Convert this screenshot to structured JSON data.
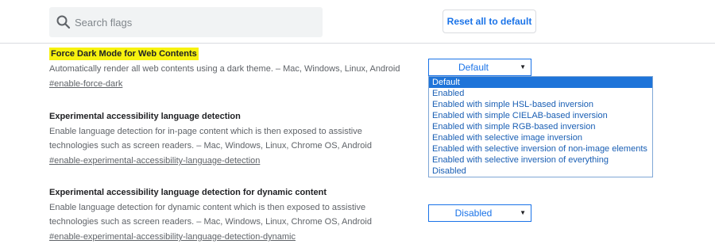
{
  "search": {
    "placeholder": "Search flags"
  },
  "reset_button": "Reset all to default",
  "flags": [
    {
      "title": "Force Dark Mode for Web Contents",
      "description": "Automatically render all web contents using a dark theme. – Mac, Windows, Linux, Android",
      "link": "#enable-force-dark",
      "selected": "Default"
    },
    {
      "title": "Experimental accessibility language detection",
      "description_line1": "Enable language detection for in-page content which is then exposed to assistive",
      "description_line2": "technologies such as screen readers. – Mac, Windows, Linux, Chrome OS, Android",
      "link": "#enable-experimental-accessibility-language-detection"
    },
    {
      "title": "Experimental accessibility language detection for dynamic content",
      "description_line1": "Enable language detection for dynamic content which is then exposed to assistive",
      "description_line2": "technologies such as screen readers. – Mac, Windows, Linux, Chrome OS, Android",
      "link": "#enable-experimental-accessibility-language-detection-dynamic",
      "selected": "Disabled"
    }
  ],
  "dropdown_options": [
    "Default",
    "Enabled",
    "Enabled with simple HSL-based inversion",
    "Enabled with simple CIELAB-based inversion",
    "Enabled with simple RGB-based inversion",
    "Enabled with selective image inversion",
    "Enabled with selective inversion of non-image elements",
    "Enabled with selective inversion of everything",
    "Disabled"
  ],
  "colors": {
    "accent": "#1a73e8",
    "highlight": "#f7f20f",
    "selected_option": "#1e74d9"
  },
  "icons": {
    "search": "search-icon",
    "dropdown_arrow": "chevron-down-icon"
  }
}
